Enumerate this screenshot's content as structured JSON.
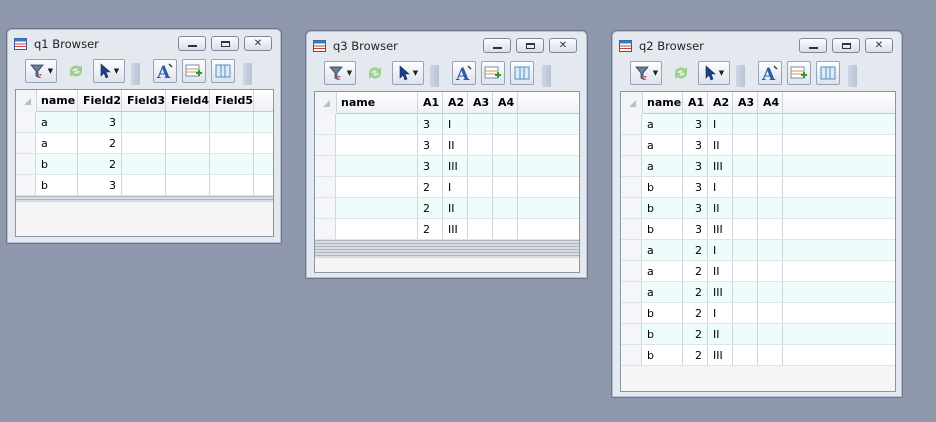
{
  "windows": {
    "q1": {
      "title": "q1 Browser",
      "columns": [
        "name",
        "Field2",
        "Field3",
        "Field4",
        "Field5"
      ],
      "rows": [
        [
          "a",
          "3",
          "",
          "",
          ""
        ],
        [
          "a",
          "2",
          "",
          "",
          ""
        ],
        [
          "b",
          "2",
          "",
          "",
          ""
        ],
        [
          "b",
          "3",
          "",
          "",
          ""
        ]
      ]
    },
    "q3": {
      "title": "q3 Browser",
      "columns": [
        "name",
        "A1",
        "A2",
        "A3",
        "A4"
      ],
      "rows": [
        [
          "",
          "3",
          "I",
          "",
          ""
        ],
        [
          "",
          "3",
          "II",
          "",
          ""
        ],
        [
          "",
          "3",
          "III",
          "",
          ""
        ],
        [
          "",
          "2",
          "I",
          "",
          ""
        ],
        [
          "",
          "2",
          "II",
          "",
          ""
        ],
        [
          "",
          "2",
          "III",
          "",
          ""
        ]
      ]
    },
    "q2": {
      "title": "q2 Browser",
      "columns": [
        "name",
        "A1",
        "A2",
        "A3",
        "A4"
      ],
      "rows": [
        [
          "a",
          "3",
          "I",
          "",
          ""
        ],
        [
          "a",
          "3",
          "II",
          "",
          ""
        ],
        [
          "a",
          "3",
          "III",
          "",
          ""
        ],
        [
          "b",
          "3",
          "I",
          "",
          ""
        ],
        [
          "b",
          "3",
          "II",
          "",
          ""
        ],
        [
          "b",
          "3",
          "III",
          "",
          ""
        ],
        [
          "a",
          "2",
          "I",
          "",
          ""
        ],
        [
          "a",
          "2",
          "II",
          "",
          ""
        ],
        [
          "a",
          "2",
          "III",
          "",
          ""
        ],
        [
          "b",
          "2",
          "I",
          "",
          ""
        ],
        [
          "b",
          "2",
          "II",
          "",
          ""
        ],
        [
          "b",
          "2",
          "III",
          "",
          ""
        ]
      ]
    }
  },
  "icons": {
    "window": "table-browser-icon",
    "sort_filter": "sort-filter-icon",
    "refresh": "refresh-icon",
    "select": "pointer-select-icon",
    "font": "font-icon",
    "add_record": "add-record-icon",
    "layout": "table-layout-icon",
    "minimize": "minimize-icon",
    "maximize": "maximize-icon",
    "close": "close-icon"
  },
  "colors": {
    "desktop": "#8e97ab",
    "row_alt": "#eefcfc",
    "refresh_green": "#5cbf3a"
  }
}
